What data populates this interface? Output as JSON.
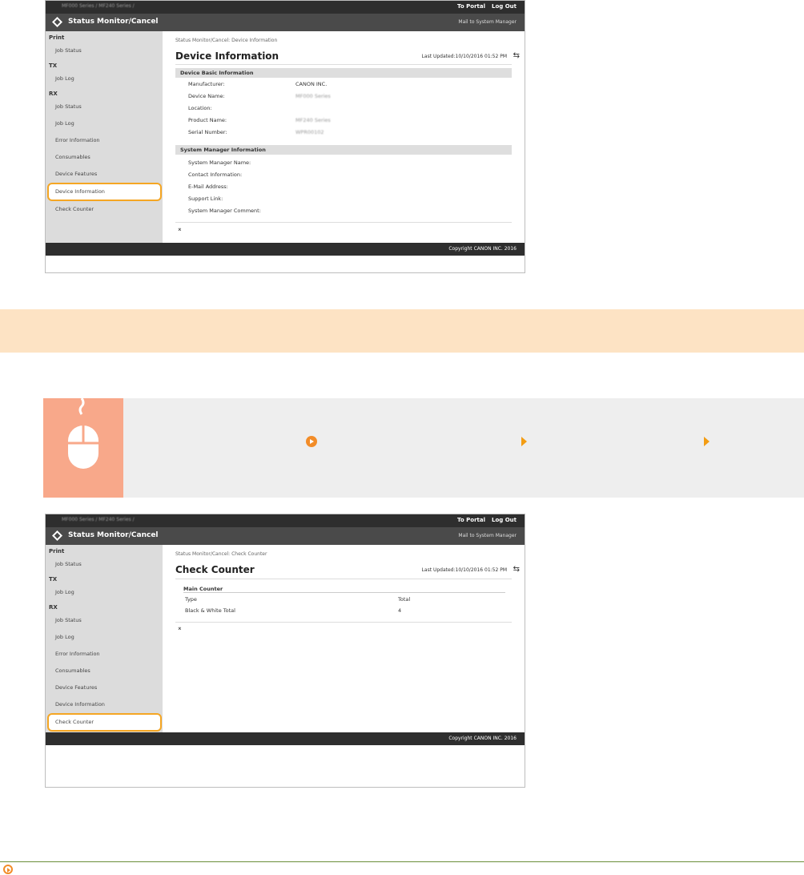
{
  "screen1": {
    "breadcrumb_path": "MF000 Series / MF240 Series /",
    "top_links": [
      "To Portal",
      "Log Out"
    ],
    "app_title": "Status Monitor/Cancel",
    "mail_link": "Mail to System Manager",
    "sidebar": [
      {
        "type": "heading",
        "label": "Print"
      },
      {
        "type": "item",
        "label": "Job Status"
      },
      {
        "type": "heading",
        "label": "TX"
      },
      {
        "type": "item",
        "label": "Job Log"
      },
      {
        "type": "heading",
        "label": "RX"
      },
      {
        "type": "item",
        "label": "Job Status"
      },
      {
        "type": "item",
        "label": "Job Log"
      },
      {
        "type": "item",
        "label": "Error Information"
      },
      {
        "type": "item",
        "label": "Consumables"
      },
      {
        "type": "item",
        "label": "Device Features"
      },
      {
        "type": "item",
        "label": "Device Information",
        "selected": true
      },
      {
        "type": "item",
        "label": "Check Counter"
      }
    ],
    "page_breadcrumb": "Status Monitor/Cancel: Device Information",
    "page_title": "Device Information",
    "last_updated": "Last Updated:10/10/2016 01:52 PM",
    "basic_section": "Device Basic Information",
    "basic_rows": [
      {
        "label": "Manufacturer:",
        "value": "CANON INC.",
        "blurred": false
      },
      {
        "label": "Device Name:",
        "value": "MF000 Series",
        "blurred": true
      },
      {
        "label": "Location:",
        "value": "",
        "blurred": false
      },
      {
        "label": "Product Name:",
        "value": "MF240 Series",
        "blurred": true
      },
      {
        "label": "Serial Number:",
        "value": "WPR00102",
        "blurred": true
      }
    ],
    "manager_section": "System Manager Information",
    "manager_rows": [
      "System Manager Name:",
      "Contact Information:",
      "E-Mail Address:",
      "Support Link:",
      "System Manager Comment:"
    ],
    "to_top": "⌅",
    "footer": "Copyright CANON INC. 2016"
  },
  "screen2": {
    "breadcrumb_path": "MF000 Series / MF240 Series /",
    "top_links": [
      "To Portal",
      "Log Out"
    ],
    "app_title": "Status Monitor/Cancel",
    "mail_link": "Mail to System Manager",
    "sidebar": [
      {
        "type": "heading",
        "label": "Print"
      },
      {
        "type": "item",
        "label": "Job Status"
      },
      {
        "type": "heading",
        "label": "TX"
      },
      {
        "type": "item",
        "label": "Job Log"
      },
      {
        "type": "heading",
        "label": "RX"
      },
      {
        "type": "item",
        "label": "Job Status"
      },
      {
        "type": "item",
        "label": "Job Log"
      },
      {
        "type": "item",
        "label": "Error Information"
      },
      {
        "type": "item",
        "label": "Consumables"
      },
      {
        "type": "item",
        "label": "Device Features"
      },
      {
        "type": "item",
        "label": "Device Information"
      },
      {
        "type": "item",
        "label": "Check Counter",
        "selected": true
      }
    ],
    "page_breadcrumb": "Status Monitor/Cancel: Check Counter",
    "page_title": "Check Counter",
    "last_updated": "Last Updated:10/10/2016 01:52 PM",
    "counter_section": "Main Counter",
    "counter_header": [
      "Type",
      "Total"
    ],
    "counter_rows": [
      [
        "Black & White Total",
        "4"
      ]
    ],
    "to_top": "⌅",
    "footer": "Copyright CANON INC. 2016"
  },
  "colors": {
    "accent": "#f5a623",
    "banner": "#fde3c4",
    "mouse_tile": "#f8a88a",
    "instruction_bg": "#eeeeee",
    "topbar": "#2e2e2e",
    "titlebar": "#4a4a4a"
  },
  "icons": [
    "canon-logo-icon",
    "refresh-icon",
    "mouse-icon",
    "circle-arrow-icon",
    "triangle-arrow-icon"
  ]
}
